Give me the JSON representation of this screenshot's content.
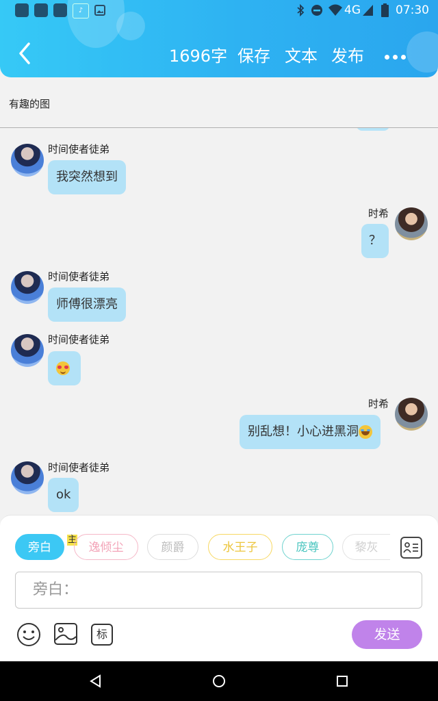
{
  "status_bar": {
    "time": "07:30",
    "network": "4G",
    "icons": [
      "app-icon",
      "app-icon",
      "app-icon",
      "music-app-icon",
      "image-icon",
      "bluetooth-icon",
      "dnd-icon",
      "wifi-icon",
      "signal-icon",
      "battery-icon"
    ]
  },
  "header": {
    "word_count": "1696字",
    "save_label": "保存",
    "text_label": "文本",
    "publish_label": "发布"
  },
  "title": "有趣的图",
  "messages": [
    {
      "side": "left",
      "sender": "时间使者徒弟",
      "text": "我突然想到"
    },
    {
      "side": "right",
      "sender": "时希",
      "text": "？"
    },
    {
      "side": "left",
      "sender": "时间使者徒弟",
      "text": "师傅很漂亮"
    },
    {
      "side": "left",
      "sender": "时间使者徒弟",
      "text": "",
      "emoji": "heart-eyes-emoji"
    },
    {
      "side": "right",
      "sender": "时希",
      "text": "别乱想！小心进黑洞",
      "emoji": "laughing-tears-emoji"
    },
    {
      "side": "left",
      "sender": "时间使者徒弟",
      "text": "ok"
    }
  ],
  "composer": {
    "roles": [
      {
        "label": "旁白",
        "active": true
      },
      {
        "label": "逸倾尘",
        "badge": "主",
        "color": "#f5b8c8"
      },
      {
        "label": "颜爵",
        "color": "#dcdcdc"
      },
      {
        "label": "水王子",
        "color": "#f7d862"
      },
      {
        "label": "庞尊",
        "color": "#6fd3cf"
      },
      {
        "label": "黎灰",
        "color": "#e2e2e2"
      }
    ],
    "input_placeholder": "旁白：",
    "tag_label": "标",
    "send_label": "发送"
  },
  "colors": {
    "header": "#2fb5f3",
    "bubble": "#b3e2f7",
    "active_chip": "#3cc8f4",
    "send_button": "#c083ea"
  }
}
